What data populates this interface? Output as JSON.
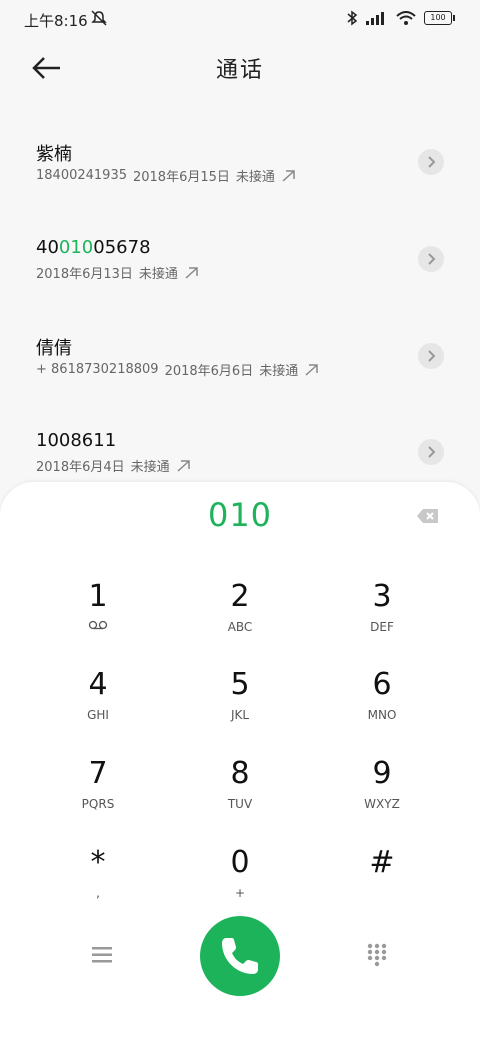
{
  "status_bar": {
    "time": "上午8:16",
    "battery": "100"
  },
  "header": {
    "title": "通话"
  },
  "calls": [
    {
      "name": "紫楠",
      "number": "18400241935",
      "date": "2018年6月15日",
      "status": "未接通"
    },
    {
      "name_parts": [
        "40",
        "010",
        "05678"
      ],
      "date": "2018年6月13日",
      "status": "未接通"
    },
    {
      "name": "倩倩",
      "number": "+ 8618730218809",
      "date": "2018年6月6日",
      "status": "未接通"
    },
    {
      "name": "1008611",
      "date": "2018年6月4日",
      "status": "未接通"
    }
  ],
  "dialer": {
    "input": "010",
    "keys": [
      {
        "num": "1",
        "sub": ""
      },
      {
        "num": "2",
        "sub": "ABC"
      },
      {
        "num": "3",
        "sub": "DEF"
      },
      {
        "num": "4",
        "sub": "GHI"
      },
      {
        "num": "5",
        "sub": "JKL"
      },
      {
        "num": "6",
        "sub": "MNO"
      },
      {
        "num": "7",
        "sub": "PQRS"
      },
      {
        "num": "8",
        "sub": "TUV"
      },
      {
        "num": "9",
        "sub": "WXYZ"
      },
      {
        "num": "*",
        "sub": ","
      },
      {
        "num": "0",
        "sub": "+"
      },
      {
        "num": "#",
        "sub": ""
      }
    ]
  },
  "colors": {
    "accent": "#1db35a",
    "background": "#f7f7f7"
  },
  "icons": {
    "back": "arrow-left-icon",
    "row_action": "chevron-right-icon",
    "outgoing": "outgoing-call-icon",
    "voicemail": "voicemail-icon",
    "backspace": "backspace-icon",
    "menu": "menu-icon",
    "call": "phone-icon",
    "keypad": "keypad-icon"
  }
}
